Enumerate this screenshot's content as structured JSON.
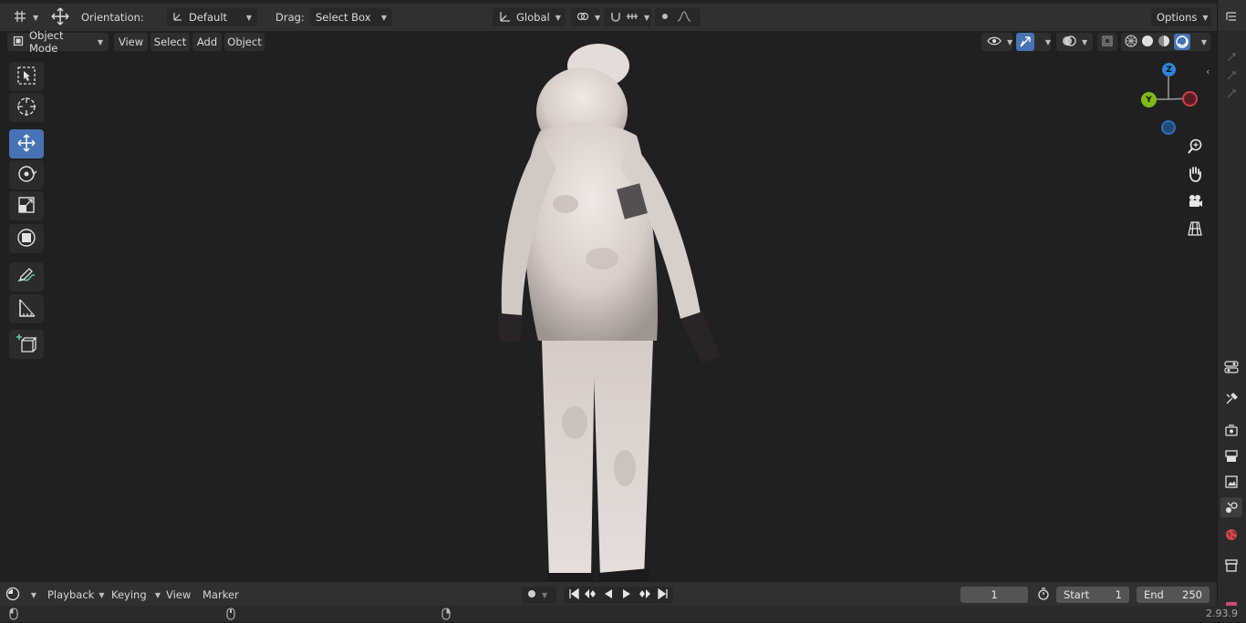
{
  "header": {
    "orientation_label": "Orientation:",
    "orientation_value": "Default",
    "drag_label": "Drag:",
    "drag_value": "Select Box",
    "transform_space": "Global",
    "options_label": "Options"
  },
  "viewport_header": {
    "mode": "Object Mode",
    "menus": [
      "View",
      "Select",
      "Add",
      "Object"
    ]
  },
  "gizmo": {
    "z": "Z",
    "y": "Y"
  },
  "timeline": {
    "menus": [
      "Playback",
      "Keying",
      "View",
      "Marker"
    ],
    "current_frame": "1",
    "start_label": "Start",
    "start_value": "1",
    "end_label": "End",
    "end_value": "250"
  },
  "status": {
    "version": "2.93.9"
  },
  "colors": {
    "active_tool": "#4772b3",
    "axis_x": "#c8414e",
    "axis_y": "#7fb91b",
    "axis_z": "#2f83d8"
  }
}
